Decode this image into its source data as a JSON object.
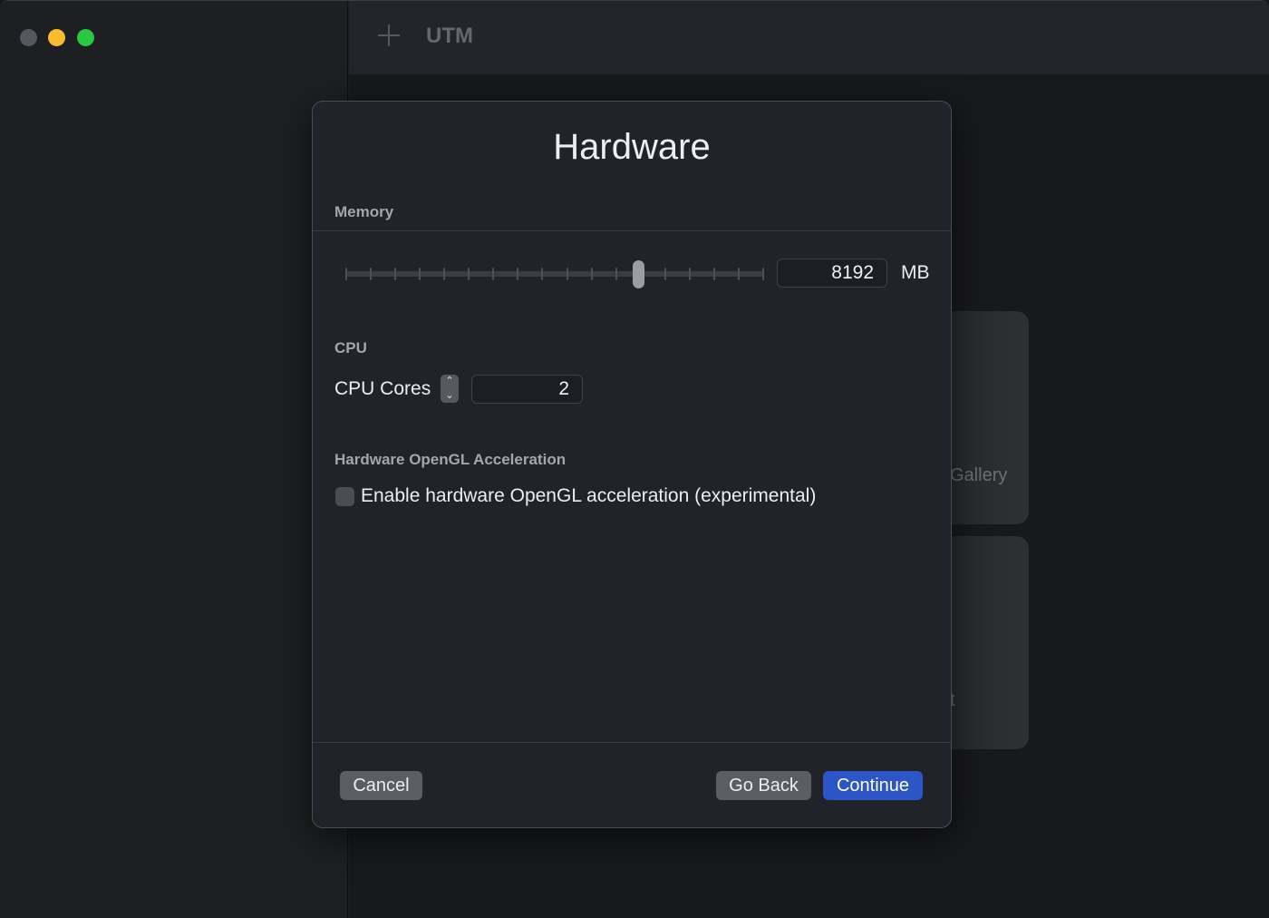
{
  "window": {
    "app_title": "UTM",
    "traffic_lights": [
      "close",
      "minimize",
      "maximize"
    ],
    "colors": {
      "minimize": "#f8bc2e",
      "maximize": "#28c840",
      "close_inactive": "#55575c"
    }
  },
  "toolbar": {
    "add_icon": "plus-icon"
  },
  "background_cards": [
    {
      "label": "Gallery"
    },
    {
      "label": "t"
    }
  ],
  "dialog": {
    "title": "Hardware",
    "memory": {
      "section_label": "Memory",
      "slider_ticks": 18,
      "slider_fraction": 0.7,
      "value": "8192",
      "unit": "MB"
    },
    "cpu": {
      "section_label": "CPU",
      "field_label": "CPU Cores",
      "value": "2",
      "stepper_up": "⌃",
      "stepper_down": "⌄"
    },
    "opengl": {
      "section_label": "Hardware OpenGL Acceleration",
      "checkbox_label": "Enable hardware OpenGL acceleration (experimental)",
      "checked": false
    },
    "buttons": {
      "cancel": "Cancel",
      "go_back": "Go Back",
      "continue": "Continue"
    },
    "accent_color": "#2c55c5"
  }
}
